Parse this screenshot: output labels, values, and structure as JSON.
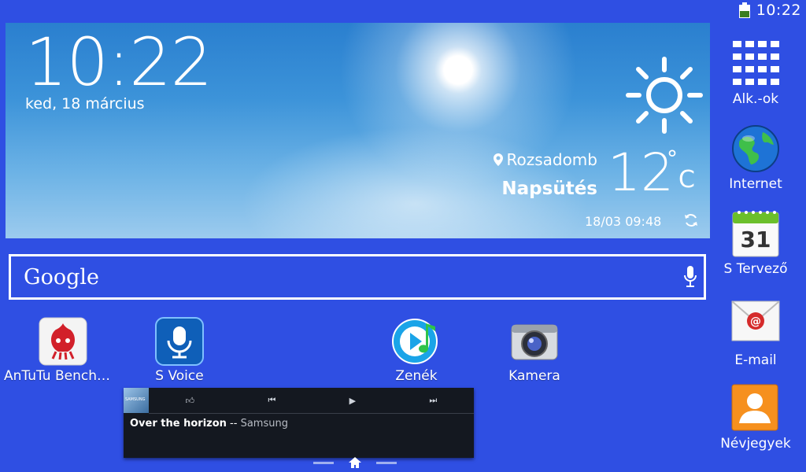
{
  "status_bar": {
    "time": "10:22"
  },
  "weather": {
    "time": "10:22",
    "date": "ked, 18 március",
    "location": "Rozsadomb",
    "condition": "Napsütés",
    "temperature": "12",
    "degree_symbol": "°",
    "unit": "C",
    "updated": "18/03 09:48"
  },
  "search": {
    "logo": "Google"
  },
  "apps": [
    {
      "label": "AnTuTu Benchm..."
    },
    {
      "label": "S Voice"
    },
    {
      "label": "Zenék"
    },
    {
      "label": "Kamera"
    }
  ],
  "dock": [
    {
      "label": "Alk.-ok"
    },
    {
      "label": "Internet"
    },
    {
      "label": "S Tervező",
      "day": "31"
    },
    {
      "label": "E-mail"
    },
    {
      "label": "Névjegyek"
    }
  ],
  "music": {
    "album_text": "SAMSUNG",
    "song": "Over the horizon",
    "separator": " -- ",
    "artist": "Samsung"
  },
  "colors": {
    "background": "#2f4fe3",
    "music_bg": "#141820"
  }
}
